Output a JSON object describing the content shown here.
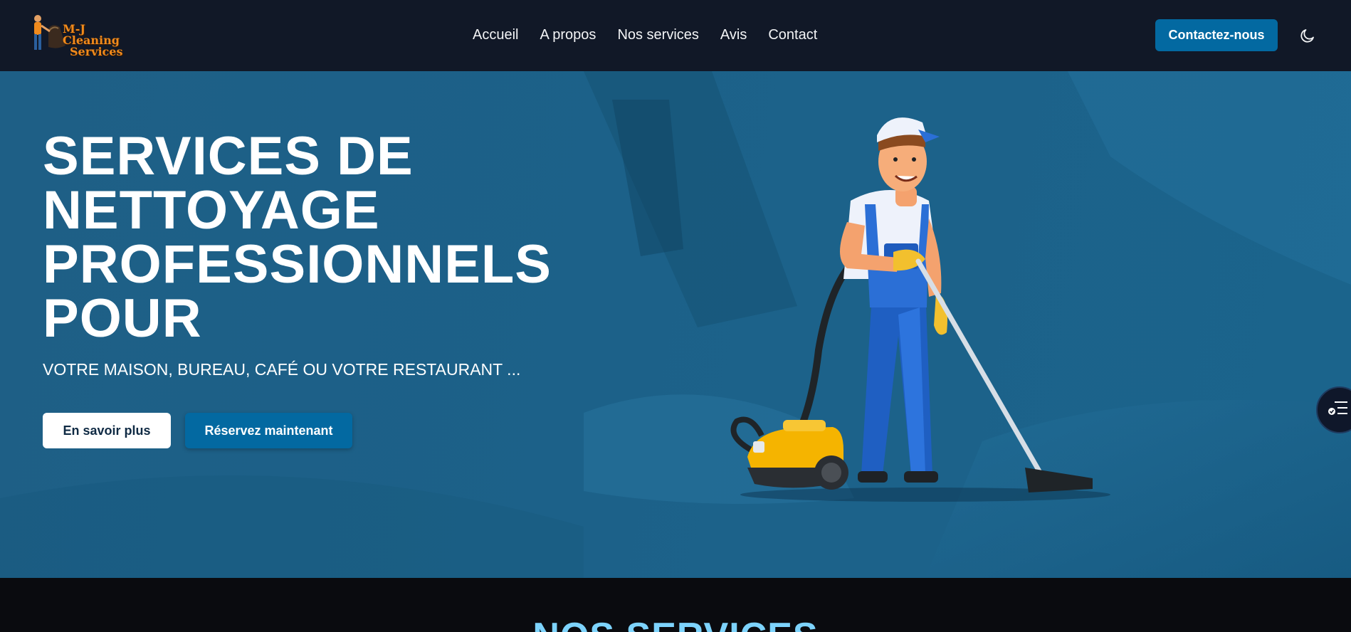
{
  "brand": {
    "logo_line1": "M-J Cleaning",
    "logo_line2": "Services",
    "logo_color": "#f08a1c"
  },
  "nav": {
    "items": [
      {
        "label": "Accueil"
      },
      {
        "label": "A propos"
      },
      {
        "label": "Nos services"
      },
      {
        "label": "Avis"
      },
      {
        "label": "Contact"
      }
    ],
    "contact_button": "Contactez-nous",
    "theme_toggle_icon": "moon-icon"
  },
  "hero": {
    "title_lines": [
      "SERVICES DE",
      "NETTOYAGE",
      "PROFESSIONNELS",
      "POUR"
    ],
    "subtitle": "VOTRE MAISON, BUREAU, CAFÉ OU VOTRE RESTAURANT ...",
    "learn_more_button": "En savoir plus",
    "book_button": "Réservez maintenant",
    "illustration": "cleaner-with-vacuum",
    "floating_button_icon": "checklist-icon"
  },
  "services": {
    "title": "NOS SERVICES"
  },
  "colors": {
    "header_bg": "#111827",
    "hero_bg": "#1c6189",
    "accent": "#0369a1",
    "services_title": "#7dd3fc"
  }
}
